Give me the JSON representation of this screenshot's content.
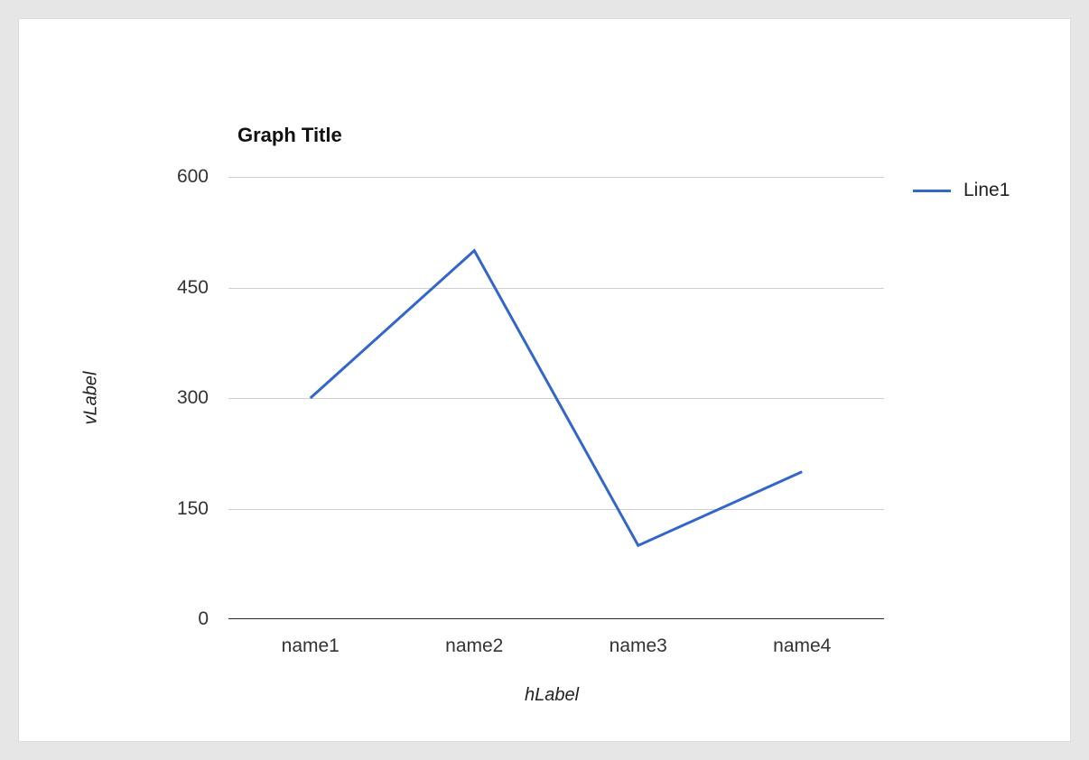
{
  "chart_data": {
    "type": "line",
    "title": "Graph Title",
    "xlabel": "hLabel",
    "ylabel": "vLabel",
    "categories": [
      "name1",
      "name2",
      "name3",
      "name4"
    ],
    "y_ticks": [
      0,
      150,
      300,
      450,
      600
    ],
    "ylim": [
      0,
      600
    ],
    "series": [
      {
        "name": "Line1",
        "values": [
          300,
          500,
          100,
          200
        ],
        "color": "#3366cc"
      }
    ],
    "legend_position": "right",
    "grid": true
  }
}
